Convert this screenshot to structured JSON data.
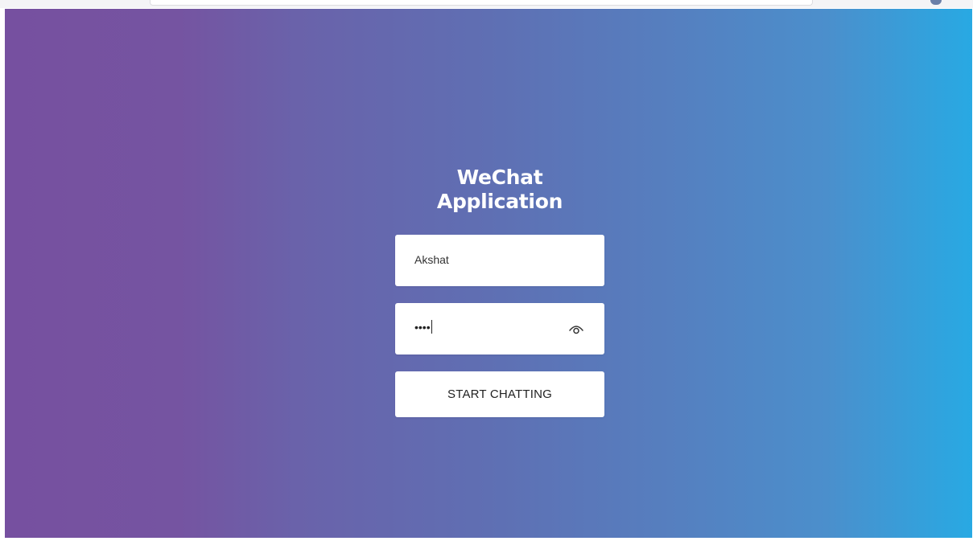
{
  "page": {
    "title": "WeChat Application"
  },
  "form": {
    "username_value": "Akshat",
    "password_mask": "••••",
    "password_toggle_icon": "eye-icon",
    "submit_label": "START CHATTING"
  },
  "colors": {
    "gradient_start": "#7650a0",
    "gradient_end": "#28a9e3",
    "field_background": "#ffffff",
    "title_text": "#ffffff"
  }
}
